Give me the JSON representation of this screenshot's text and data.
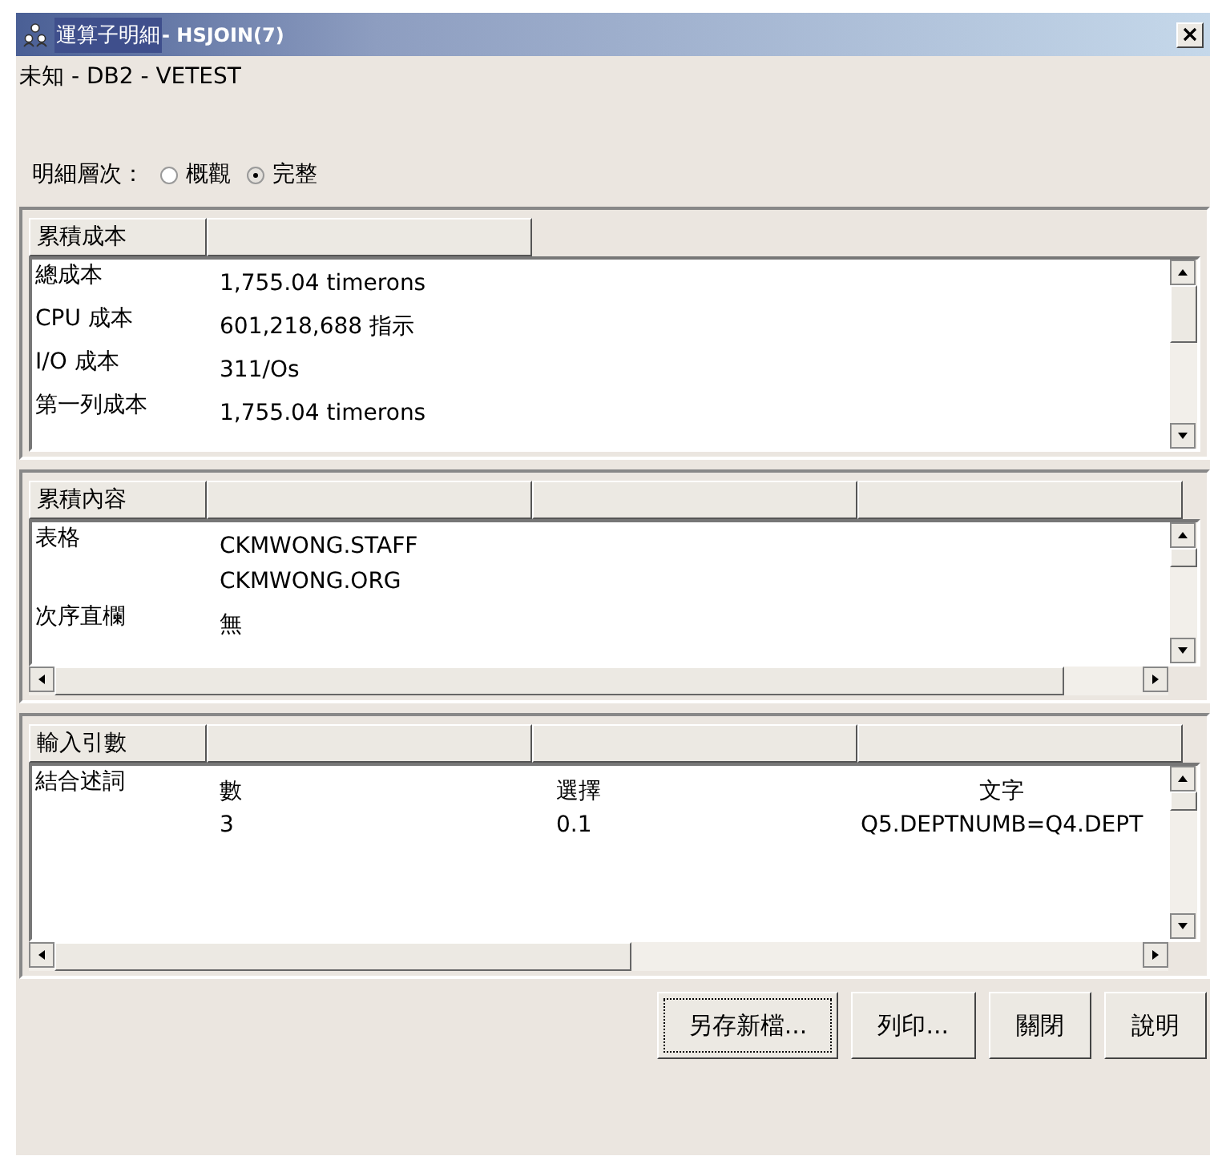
{
  "window": {
    "title": "運算子明細",
    "subtitle": " - HSJOIN(7)"
  },
  "context": "未知 - DB2 - VETEST",
  "detail_level": {
    "label": "明細層次：",
    "options": [
      {
        "label": "概觀",
        "selected": false
      },
      {
        "label": "完整",
        "selected": true
      }
    ]
  },
  "panels": [
    {
      "kind": "list",
      "header": "累積成本",
      "rows": [
        {
          "label": "總成本",
          "values": [
            "1,755.04  timerons"
          ]
        },
        {
          "label": "CPU 成本",
          "values": [
            "601,218,688  指示"
          ]
        },
        {
          "label": "I/O 成本",
          "values": [
            "311/Os"
          ]
        },
        {
          "label": "第一列成本",
          "values": [
            "1,755.04 timerons"
          ]
        }
      ]
    },
    {
      "kind": "list-wide",
      "header": "累積內容",
      "rows": [
        {
          "label": "表格",
          "values": [
            "CKMWONG.STAFF",
            "CKMWONG.ORG"
          ]
        },
        {
          "label": "次序直欄",
          "values": [
            "無"
          ]
        }
      ]
    },
    {
      "kind": "table",
      "header": "輸入引數",
      "rows": [
        {
          "label": "結合述詞",
          "columns": [
            {
              "heading": "數",
              "value": "3"
            },
            {
              "heading": "選擇",
              "value": "0.1"
            },
            {
              "heading": "文字",
              "value": "Q5.DEPTNUMB=Q4.DEPT"
            }
          ]
        }
      ]
    }
  ],
  "buttons": [
    {
      "label": "另存新檔...",
      "focused": true
    },
    {
      "label": "列印...",
      "focused": false
    },
    {
      "label": "關閉",
      "focused": false
    },
    {
      "label": "說明",
      "focused": false
    }
  ]
}
